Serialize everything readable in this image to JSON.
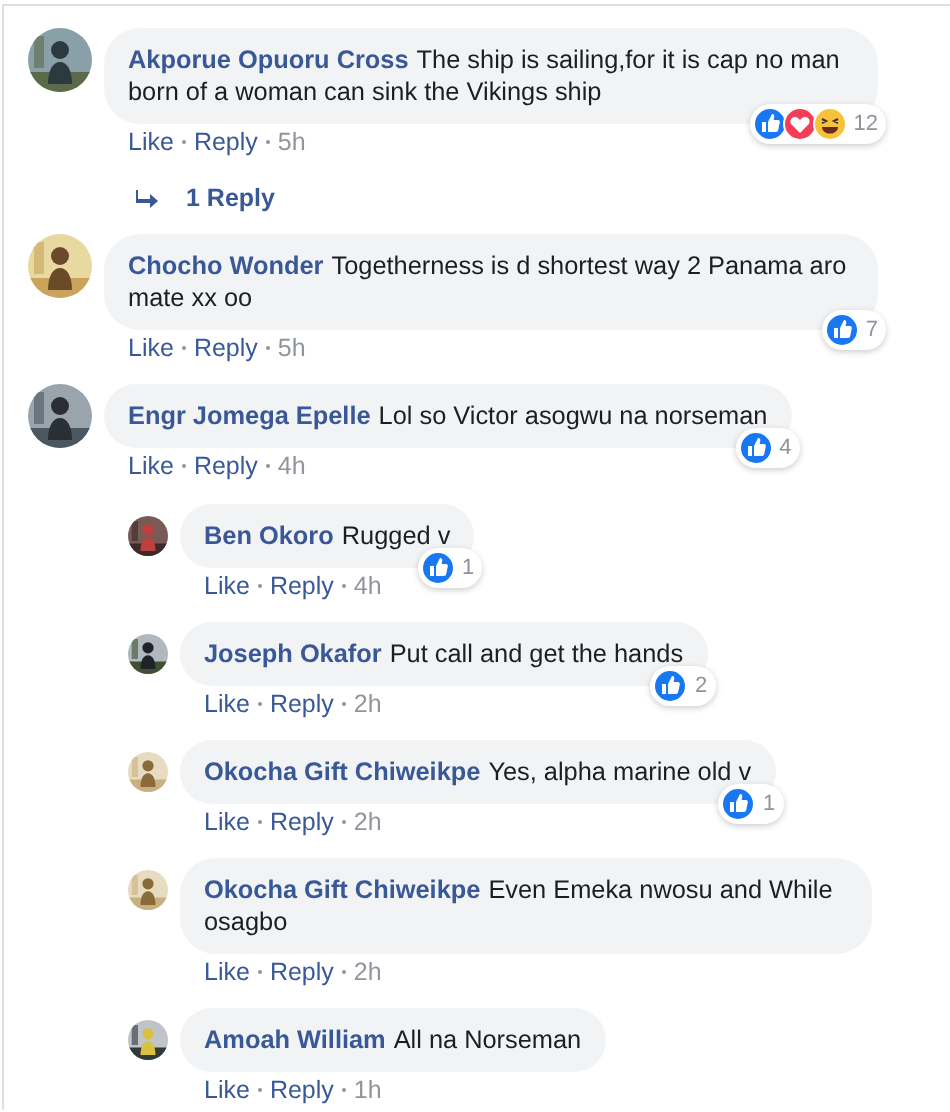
{
  "comments": [
    {
      "name": "Akporue Opuoru Cross",
      "text": "The ship is sailing,for it is cap no man born of a woman can sink the Vikings ship",
      "actions": [
        "Like",
        "Reply"
      ],
      "time": "5h",
      "reactions": {
        "items": [
          {
            "kind": "like"
          },
          {
            "kind": "love"
          },
          {
            "kind": "haha"
          }
        ],
        "count": "12"
      },
      "replies_link": "1 Reply"
    },
    {
      "name": "Chocho Wonder",
      "text": "Togetherness is d shortest way 2 Panama aro mate xx oo",
      "actions": [
        "Like",
        "Reply"
      ],
      "time": "5h",
      "reactions": {
        "items": [
          {
            "kind": "like"
          }
        ],
        "count": "7"
      }
    },
    {
      "name": "Engr Jomega Epelle",
      "text": "Lol so Victor asogwu na norseman",
      "actions": [
        "Like",
        "Reply"
      ],
      "time": "4h",
      "reactions": {
        "items": [
          {
            "kind": "like"
          }
        ],
        "count": "4"
      },
      "replies": [
        {
          "name": "Ben Okoro",
          "text": "Rugged v",
          "actions": [
            "Like",
            "Reply"
          ],
          "time": "4h",
          "reactions": {
            "items": [
              {
                "kind": "like"
              }
            ],
            "count": "1"
          }
        },
        {
          "name": "Joseph Okafor",
          "text": "Put call and get the hands",
          "actions": [
            "Like",
            "Reply"
          ],
          "time": "2h",
          "reactions": {
            "items": [
              {
                "kind": "like"
              }
            ],
            "count": "2"
          }
        },
        {
          "name": "Okocha Gift Chiweikpe",
          "text": "Yes, alpha marine old v",
          "actions": [
            "Like",
            "Reply"
          ],
          "time": "2h",
          "reactions": {
            "items": [
              {
                "kind": "like"
              }
            ],
            "count": "1"
          }
        },
        {
          "name": "Okocha Gift Chiweikpe",
          "text": "Even Emeka nwosu and While osagbo",
          "actions": [
            "Like",
            "Reply"
          ],
          "time": "2h"
        },
        {
          "name": "Amoah William",
          "text": "All na Norseman",
          "actions": [
            "Like",
            "Reply"
          ],
          "time": "1h"
        }
      ]
    }
  ]
}
